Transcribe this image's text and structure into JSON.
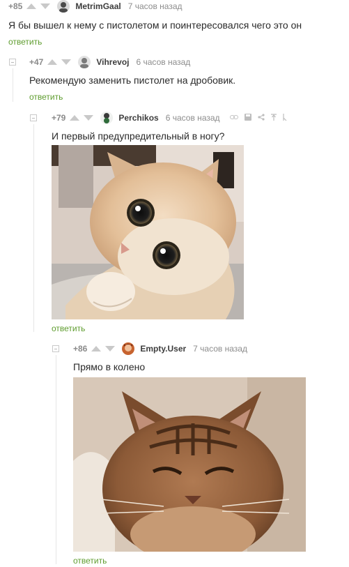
{
  "comments": [
    {
      "rating": "+85",
      "username": "MetrimGaal",
      "time": "7 часов назад",
      "text": "Я бы вышел к нему с пистолетом и поинтересовался чего это он",
      "reply": "ответить",
      "avatar_icon": "user-avatar-icon",
      "avatar_color": "#4a4a4a"
    },
    {
      "rating": "+47",
      "username": "Vihrevoj",
      "time": "6 часов назад",
      "text": "Рекомендую заменить пистолет на дробовик.",
      "reply": "ответить",
      "avatar_icon": "user-avatar-icon",
      "avatar_color": "#7a7a7a"
    },
    {
      "rating": "+79",
      "username": "Perchikos",
      "time": "6 часов назад",
      "text": "И первый предупредительный в ногу?",
      "reply": "ответить",
      "avatar_icon": "user-avatar-icon",
      "avatar_color": "#2f6b3a",
      "image": "cat-photo-big-eyes"
    },
    {
      "rating": "+86",
      "username": "Empty.User",
      "time": "7 часов назад",
      "text": "Прямо в колено",
      "reply": "ответить",
      "avatar_icon": "user-avatar-icon",
      "avatar_color": "#8b3a1e",
      "image": "cat-photo-tabby"
    }
  ],
  "colors": {
    "reply_link": "#5e9c2e",
    "rating": "#8a8a8a",
    "meta": "#8c8c8c"
  },
  "toolbar_icons": [
    "link-icon",
    "save-icon",
    "share-icon",
    "pin-icon",
    "more-icon"
  ]
}
